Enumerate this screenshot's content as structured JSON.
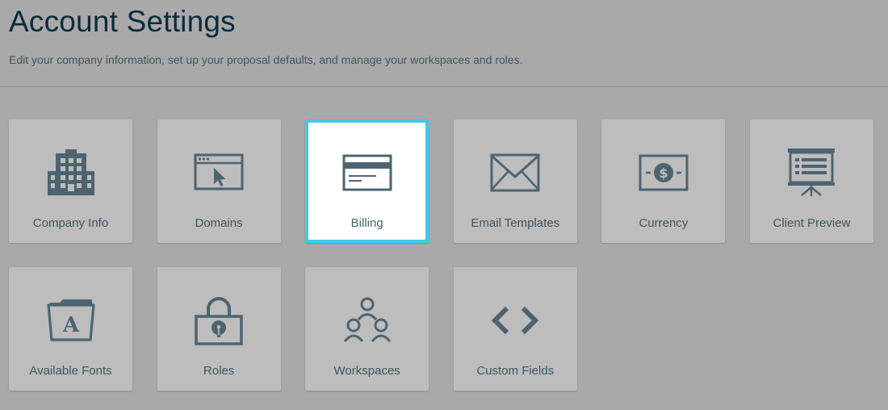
{
  "header": {
    "title": "Account Settings",
    "subtitle": "Edit your company information, set up your proposal defaults, and manage your workspaces and roles."
  },
  "colors": {
    "background": "#a9a9a9",
    "tile": "#bdbdbd",
    "icon": "#4d6470",
    "title": "#0c2b3a",
    "selected_border": "#3fc9ea"
  },
  "tiles": [
    {
      "label": "Company Info",
      "icon": "building-icon",
      "selected": false
    },
    {
      "label": "Domains",
      "icon": "browser-cursor-icon",
      "selected": false
    },
    {
      "label": "Billing",
      "icon": "credit-card-icon",
      "selected": true
    },
    {
      "label": "Email Templates",
      "icon": "envelope-icon",
      "selected": false
    },
    {
      "label": "Currency",
      "icon": "banknote-icon",
      "selected": false
    },
    {
      "label": "Client Preview",
      "icon": "presentation-icon",
      "selected": false
    },
    {
      "label": "Available Fonts",
      "icon": "font-folder-icon",
      "selected": false
    },
    {
      "label": "Roles",
      "icon": "padlock-icon",
      "selected": false
    },
    {
      "label": "Workspaces",
      "icon": "people-group-icon",
      "selected": false
    },
    {
      "label": "Custom Fields",
      "icon": "code-brackets-icon",
      "selected": false
    }
  ]
}
